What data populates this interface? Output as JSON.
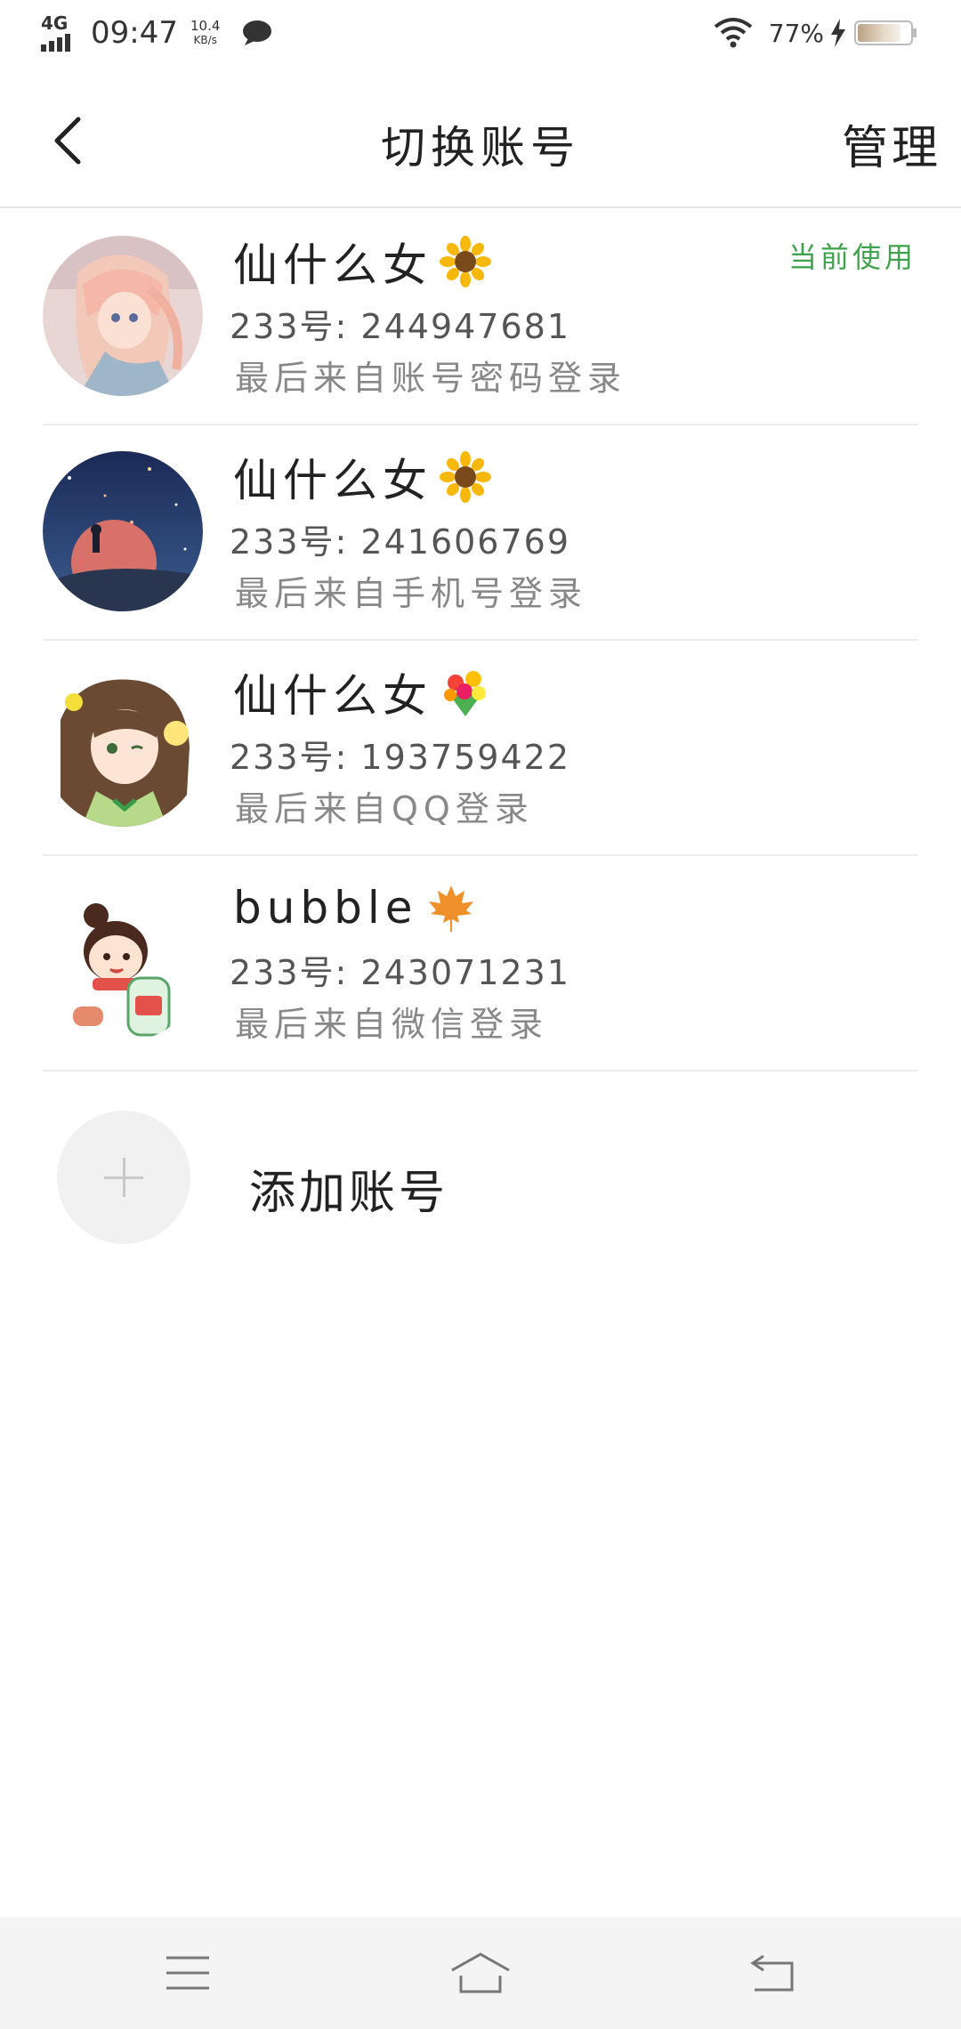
{
  "status_bar": {
    "network": "4G",
    "time": "09:47",
    "speed_value": "10.4",
    "speed_unit": "KB/s",
    "battery": "77%",
    "icons": [
      "signal-icon",
      "message-icon",
      "wifi-icon",
      "charging-icon",
      "battery-icon"
    ]
  },
  "header": {
    "title": "切换账号",
    "manage": "管理"
  },
  "accounts": [
    {
      "name": "仙什么女",
      "id": "233号: 244947681",
      "login": "最后来自账号密码登录",
      "badge": "当前使用",
      "emoji": "sunflower-icon"
    },
    {
      "name": "仙什么女",
      "id": "233号: 241606769",
      "login": "最后来自手机号登录",
      "badge": "",
      "emoji": "sunflower-icon"
    },
    {
      "name": "仙什么女",
      "id": "233号: 193759422",
      "login": "最后来自QQ登录",
      "badge": "",
      "emoji": "bouquet-icon"
    },
    {
      "name": "bubble",
      "id": "233号: 243071231",
      "login": "最后来自微信登录",
      "badge": "",
      "emoji": "maple-leaf-icon"
    }
  ],
  "add_account": {
    "label": "添加账号"
  },
  "colors": {
    "accent_green": "#3fa34d",
    "divider": "#ececec",
    "nav_background": "#f4f4f4"
  }
}
